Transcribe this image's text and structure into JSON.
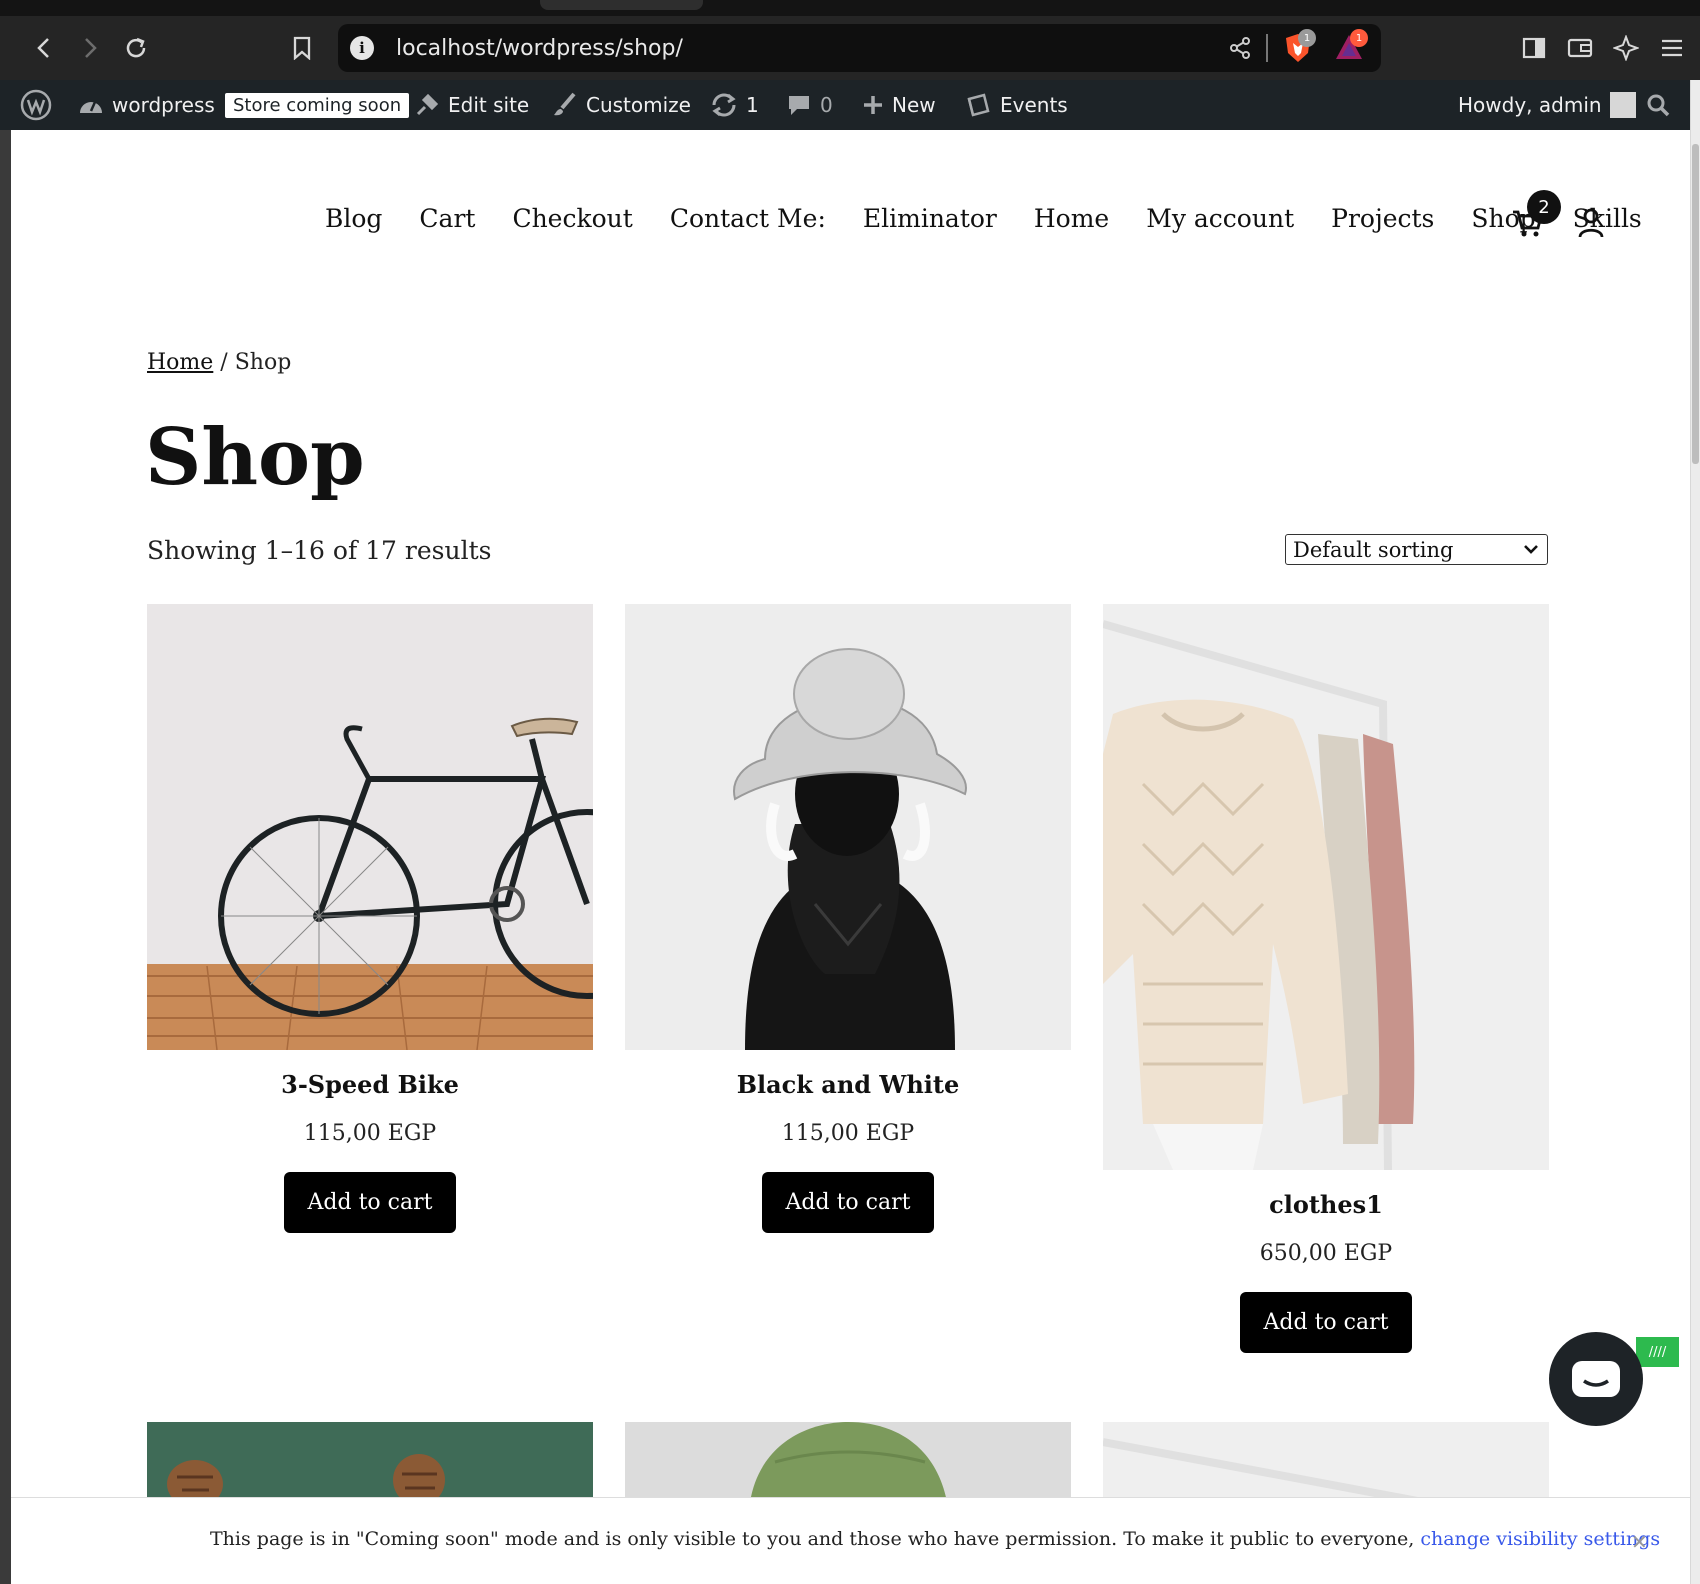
{
  "browser": {
    "url": "localhost/wordpress/shop/",
    "shield_badge": "1",
    "triangle_badge": "1"
  },
  "admin_bar": {
    "site_name": "wordpress",
    "store_status": "Store coming soon",
    "edit_site": "Edit site",
    "customize": "Customize",
    "updates_count": "1",
    "comments_count": "0",
    "new_label": "New",
    "events_label": "Events",
    "greeting": "Howdy, admin"
  },
  "nav": {
    "items": [
      "Blog",
      "Cart",
      "Checkout",
      "Contact Me:",
      "Eliminator",
      "Home",
      "My account",
      "Projects",
      "Shop",
      "Skills"
    ],
    "cart_count": "2"
  },
  "breadcrumb": {
    "home": "Home",
    "separator": " / ",
    "current": "Shop"
  },
  "page_title": "Shop",
  "result_count": "Showing 1–16 of 17 results",
  "sorting": {
    "selected": "Default sorting"
  },
  "products": [
    {
      "name": "3-Speed Bike",
      "price": "115,00 EGP",
      "button": "Add to cart"
    },
    {
      "name": "Black and White",
      "price": "115,00 EGP",
      "button": "Add to cart"
    },
    {
      "name": "clothes1",
      "price": "650,00 EGP",
      "button": "Add to cart"
    }
  ],
  "notice": {
    "text": "This page is in \"Coming soon\" mode and is only visible to you and those who have permission. To make it public to everyone, ",
    "link": "change visibility settings"
  },
  "colors": {
    "admin_bar_bg": "#1d2327",
    "button_bg": "#000000",
    "link_blue": "#3858e9"
  }
}
